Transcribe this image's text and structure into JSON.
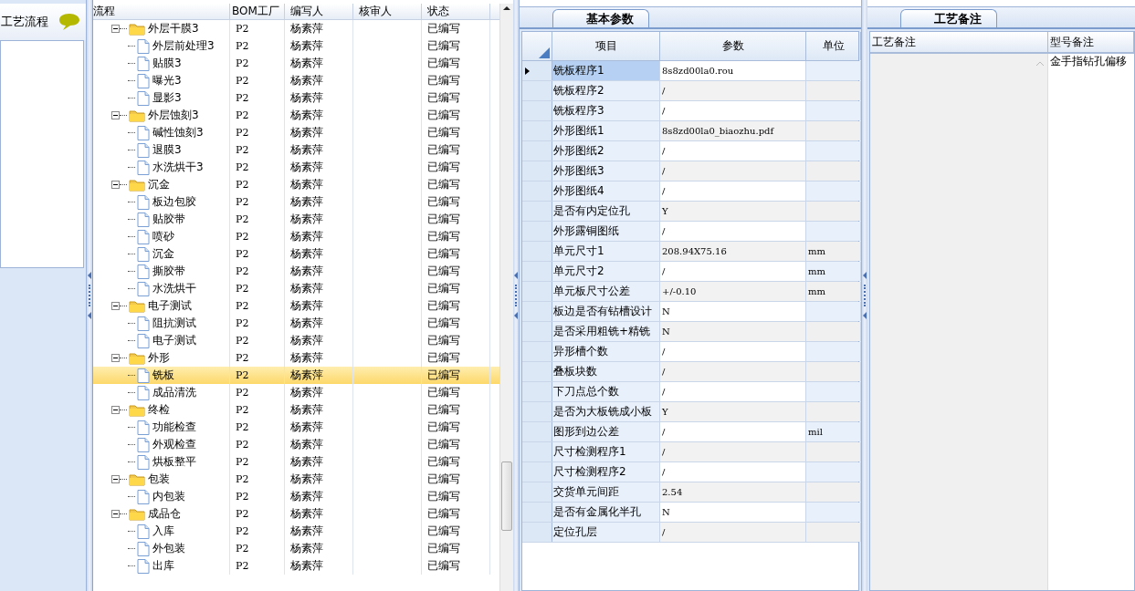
{
  "sidebar": {
    "title": "工艺流程"
  },
  "flow_table": {
    "columns": [
      "流程",
      "BOM工厂",
      "编写人",
      "核审人",
      "状态"
    ],
    "groups": [
      {
        "label": "外层干膜3",
        "bom": "P2",
        "author": "杨素萍",
        "status": "已编写",
        "expanded": true,
        "selected": false,
        "children": [
          {
            "label": "外层前处理3",
            "bom": "P2",
            "author": "杨素萍",
            "status": "已编写",
            "selected": false
          },
          {
            "label": "贴膜3",
            "bom": "P2",
            "author": "杨素萍",
            "status": "已编写",
            "selected": false
          },
          {
            "label": "曝光3",
            "bom": "P2",
            "author": "杨素萍",
            "status": "已编写",
            "selected": false
          },
          {
            "label": "显影3",
            "bom": "P2",
            "author": "杨素萍",
            "status": "已编写",
            "selected": false
          }
        ]
      },
      {
        "label": "外层蚀刻3",
        "bom": "P2",
        "author": "杨素萍",
        "status": "已编写",
        "expanded": true,
        "selected": false,
        "children": [
          {
            "label": "碱性蚀刻3",
            "bom": "P2",
            "author": "杨素萍",
            "status": "已编写",
            "selected": false
          },
          {
            "label": "退膜3",
            "bom": "P2",
            "author": "杨素萍",
            "status": "已编写",
            "selected": false
          },
          {
            "label": "水洗烘干3",
            "bom": "P2",
            "author": "杨素萍",
            "status": "已编写",
            "selected": false
          }
        ]
      },
      {
        "label": "沉金",
        "bom": "P2",
        "author": "杨素萍",
        "status": "已编写",
        "expanded": true,
        "selected": false,
        "children": [
          {
            "label": "板边包胶",
            "bom": "P2",
            "author": "杨素萍",
            "status": "已编写",
            "selected": false
          },
          {
            "label": "贴胶带",
            "bom": "P2",
            "author": "杨素萍",
            "status": "已编写",
            "selected": false
          },
          {
            "label": "喷砂",
            "bom": "P2",
            "author": "杨素萍",
            "status": "已编写",
            "selected": false
          },
          {
            "label": "沉金",
            "bom": "P2",
            "author": "杨素萍",
            "status": "已编写",
            "selected": false
          },
          {
            "label": "撕胶带",
            "bom": "P2",
            "author": "杨素萍",
            "status": "已编写",
            "selected": false
          },
          {
            "label": "水洗烘干",
            "bom": "P2",
            "author": "杨素萍",
            "status": "已编写",
            "selected": false
          }
        ]
      },
      {
        "label": "电子测试",
        "bom": "P2",
        "author": "杨素萍",
        "status": "已编写",
        "expanded": true,
        "selected": false,
        "children": [
          {
            "label": "阻抗测试",
            "bom": "P2",
            "author": "杨素萍",
            "status": "已编写",
            "selected": false
          },
          {
            "label": "电子测试",
            "bom": "P2",
            "author": "杨素萍",
            "status": "已编写",
            "selected": false
          }
        ]
      },
      {
        "label": "外形",
        "bom": "P2",
        "author": "杨素萍",
        "status": "已编写",
        "expanded": true,
        "selected": false,
        "children": [
          {
            "label": "铣板",
            "bom": "P2",
            "author": "杨素萍",
            "status": "已编写",
            "selected": true
          },
          {
            "label": "成品清洗",
            "bom": "P2",
            "author": "杨素萍",
            "status": "已编写",
            "selected": false
          }
        ]
      },
      {
        "label": "终检",
        "bom": "P2",
        "author": "杨素萍",
        "status": "已编写",
        "expanded": true,
        "selected": false,
        "children": [
          {
            "label": "功能检查",
            "bom": "P2",
            "author": "杨素萍",
            "status": "已编写",
            "selected": false
          },
          {
            "label": "外观检查",
            "bom": "P2",
            "author": "杨素萍",
            "status": "已编写",
            "selected": false
          },
          {
            "label": "烘板整平",
            "bom": "P2",
            "author": "杨素萍",
            "status": "已编写",
            "selected": false
          }
        ]
      },
      {
        "label": "包装",
        "bom": "P2",
        "author": "杨素萍",
        "status": "已编写",
        "expanded": true,
        "selected": false,
        "children": [
          {
            "label": "内包装",
            "bom": "P2",
            "author": "杨素萍",
            "status": "已编写",
            "selected": false
          }
        ]
      },
      {
        "label": "成品仓",
        "bom": "P2",
        "author": "杨素萍",
        "status": "已编写",
        "expanded": true,
        "selected": false,
        "children": [
          {
            "label": "入库",
            "bom": "P2",
            "author": "杨素萍",
            "status": "已编写",
            "selected": false
          },
          {
            "label": "外包装",
            "bom": "P2",
            "author": "杨素萍",
            "status": "已编写",
            "selected": false
          },
          {
            "label": "出库",
            "bom": "P2",
            "author": "杨素萍",
            "status": "已编写",
            "selected": false
          }
        ]
      }
    ]
  },
  "params": {
    "tab": {
      "label": "基本参数",
      "selected": true
    },
    "columns": [
      "项目",
      "参数",
      "单位"
    ],
    "rows": [
      {
        "item": "铣板程序1",
        "value": "8s8zd00la0.rou",
        "selected": true
      },
      {
        "item": "铣板程序2",
        "value": "/",
        "selected": false
      },
      {
        "item": "铣板程序3",
        "value": "/",
        "selected": false
      },
      {
        "item": "外形图纸1",
        "value": "8s8zd00la0_biaozhu.pdf",
        "selected": false
      },
      {
        "item": "外形图纸2",
        "value": "/",
        "selected": false
      },
      {
        "item": "外形图纸3",
        "value": "/",
        "selected": false
      },
      {
        "item": "外形图纸4",
        "value": "/",
        "selected": false
      },
      {
        "item": "是否有内定位孔",
        "value": "Y",
        "selected": false
      },
      {
        "item": "外形露铜图纸",
        "value": "/",
        "selected": false
      },
      {
        "item": "单元尺寸1",
        "value": "208.94X75.16",
        "unit": "mm",
        "selected": false
      },
      {
        "item": "单元尺寸2",
        "value": "/",
        "unit": "mm",
        "selected": false
      },
      {
        "item": "单元板尺寸公差",
        "value": "+/-0.10",
        "unit": "mm",
        "selected": false
      },
      {
        "item": "板边是否有钻槽设计",
        "value": "N",
        "selected": false
      },
      {
        "item": "是否采用粗铣+精铣",
        "value": "N",
        "selected": false
      },
      {
        "item": "异形槽个数",
        "value": "/",
        "selected": false
      },
      {
        "item": "叠板块数",
        "value": "/",
        "selected": false
      },
      {
        "item": "下刀点总个数",
        "value": "/",
        "selected": false
      },
      {
        "item": "是否为大板铣成小板",
        "value": "Y",
        "selected": false
      },
      {
        "item": "图形到边公差",
        "value": "/",
        "unit": "mil",
        "selected": false
      },
      {
        "item": "尺寸检测程序1",
        "value": "/",
        "selected": false
      },
      {
        "item": "尺寸检测程序2",
        "value": "/",
        "selected": false
      },
      {
        "item": "交货单元间距",
        "value": "2.54",
        "selected": false
      },
      {
        "item": "是否有金属化半孔",
        "value": "N",
        "selected": false
      },
      {
        "item": "定位孔层",
        "value": "/",
        "selected": false
      }
    ]
  },
  "notes": {
    "tab": {
      "label": "工艺备注",
      "selected": true
    },
    "columns": [
      "工艺备注",
      "型号备注"
    ],
    "model_note": "金手指钻孔偏移"
  }
}
